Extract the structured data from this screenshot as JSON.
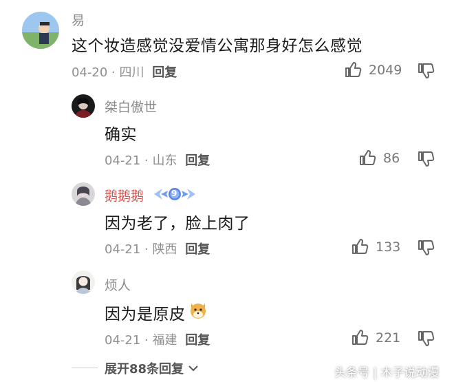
{
  "comments": [
    {
      "name": "易",
      "content": "这个妆造感觉没爱情公寓那身好怎么感觉",
      "date": "04-20",
      "location": "四川",
      "reply_label": "回复",
      "likes": "2049"
    },
    {
      "name": "桀白傲世",
      "content": "确实",
      "date": "04-21",
      "location": "山东",
      "reply_label": "回复",
      "likes": "86"
    },
    {
      "name": "鹅鹅鹅",
      "badge_text": "9",
      "content": "因为老了，脸上肉了",
      "date": "04-21",
      "location": "陕西",
      "reply_label": "回复",
      "likes": "133"
    },
    {
      "name": "烦人",
      "content": "因为是原皮",
      "date": "04-21",
      "location": "福建",
      "reply_label": "回复",
      "likes": "221"
    }
  ],
  "separator": "·",
  "expand_label": "展开88条回复",
  "watermark": "头条号 | 木子说动漫",
  "colors": {
    "name": "#8a8a8a",
    "content": "#1a1a1a",
    "meta": "#8f8f8f",
    "badge": "#6f9cf2"
  }
}
